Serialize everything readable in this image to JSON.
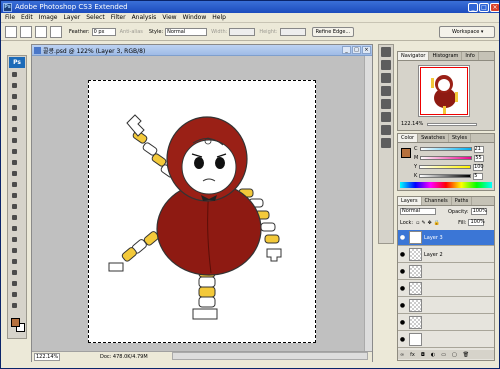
{
  "app": {
    "title": "Adobe Photoshop CS3 Extended",
    "logo": "Ps"
  },
  "window_controls": {
    "minimize": "_",
    "maximize": "□",
    "close": "×"
  },
  "menu": [
    "File",
    "Edit",
    "Image",
    "Layer",
    "Select",
    "Filter",
    "Analysis",
    "View",
    "Window",
    "Help"
  ],
  "options": {
    "feather_label": "Feather:",
    "feather_value": "0 px",
    "antialias_label": "Anti-alias",
    "style_label": "Style:",
    "style_value": "Normal",
    "width_label": "Width:",
    "height_label": "Height:",
    "refine_label": "Refine Edge...",
    "workspace_label": "Workspace ▾"
  },
  "document": {
    "title": "콜콩.psd @ 122% (Layer 3, RGB/8)",
    "zoom": "122.14%",
    "doc_size": "Doc: 478.0K/4.79M"
  },
  "navigator": {
    "tabs": [
      "Navigator",
      "Histogram",
      "Info"
    ],
    "zoom": "122.14%"
  },
  "color_panel": {
    "tabs": [
      "Color",
      "Swatches",
      "Styles"
    ],
    "fg_color": "#b5703d",
    "channels": [
      {
        "label": "C",
        "value": "21"
      },
      {
        "label": "M",
        "value": "55"
      },
      {
        "label": "Y",
        "value": "100"
      },
      {
        "label": "K",
        "value": "5"
      }
    ]
  },
  "layers": {
    "tabs": [
      "Layers",
      "Channels",
      "Paths"
    ],
    "blend_mode": "Normal",
    "opacity_label": "Opacity:",
    "opacity": "100%",
    "lock_label": "Lock:",
    "fill_label": "Fill:",
    "fill": "100%",
    "items": [
      {
        "name": "Layer 3",
        "selected": true
      },
      {
        "name": "Layer 2",
        "selected": false
      },
      {
        "name": "",
        "selected": false
      },
      {
        "name": "",
        "selected": false
      },
      {
        "name": "",
        "selected": false
      },
      {
        "name": "",
        "selected": false
      },
      {
        "name": "",
        "selected": false
      }
    ]
  }
}
